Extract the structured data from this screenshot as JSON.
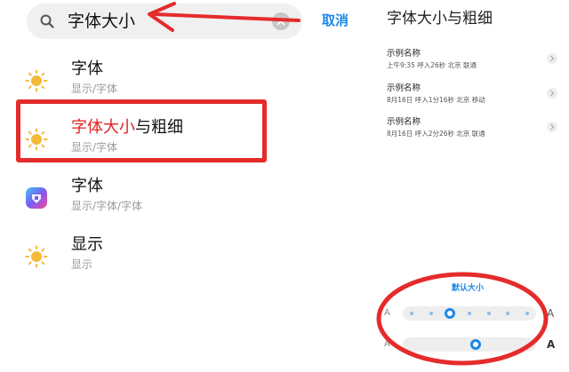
{
  "search": {
    "query": "字体大小",
    "cancel_label": "取消"
  },
  "results": [
    {
      "title_highlight": "字体",
      "title_rest": "",
      "path": "显示/字体",
      "icon": "sun-icon"
    },
    {
      "title_highlight": "字体大小",
      "title_rest": "与粗细",
      "path": "显示/字体",
      "icon": "sun-icon"
    },
    {
      "title_highlight": "",
      "title_rest": "字体",
      "path": "显示/字体/字体",
      "icon": "theme-app-icon"
    },
    {
      "title_highlight": "",
      "title_rest": "显示",
      "path": "显示",
      "icon": "sun-icon"
    }
  ],
  "right_panel": {
    "title": "字体大小与粗细",
    "samples": [
      {
        "name": "示例名称",
        "detail": "上午9:35 呼入26秒 北京 联通"
      },
      {
        "name": "示例名称",
        "detail": "8月16日 呼入1分16秒 北京 移动"
      },
      {
        "name": "示例名称",
        "detail": "8月16日 呼入2分26秒 北京 联通"
      }
    ],
    "size_label": "默认大小",
    "size_slider": {
      "small_glyph": "A",
      "large_glyph": "A",
      "steps": 7,
      "selected_index": 2
    },
    "weight_slider": {
      "small_glyph": "A",
      "large_glyph": "A",
      "value": 0.55
    }
  },
  "colors": {
    "accent": "#1e88e5",
    "highlight": "#e02020",
    "annotation": "#e52b2b",
    "sun": "#f5b93a"
  }
}
